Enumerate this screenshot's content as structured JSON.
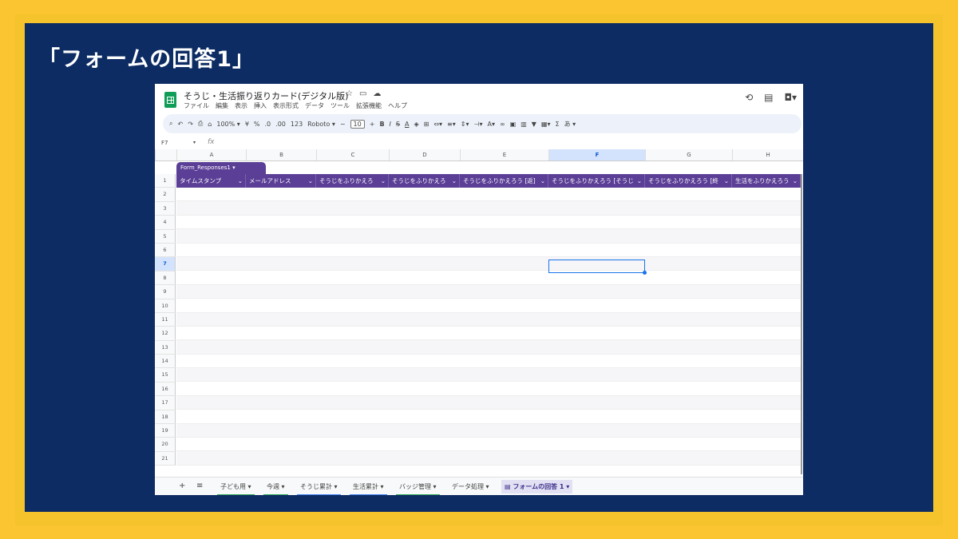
{
  "slide": {
    "title": "「フォームの回答1」"
  },
  "app": {
    "doc_title": "そうじ・生活振り返りカード(デジタル版)",
    "title_icons": [
      "star-icon",
      "folder-move-icon",
      "cloud-status-icon"
    ],
    "menu": [
      "ファイル",
      "編集",
      "表示",
      "挿入",
      "表示形式",
      "データ",
      "ツール",
      "拡張機能",
      "ヘルプ"
    ],
    "right_icons": [
      "history-icon",
      "comment-icon",
      "meet-icon"
    ]
  },
  "toolbar": {
    "zoom": "100%",
    "currency": "¥",
    "percent": "%",
    "dec_dec": ".0",
    "dec_inc": ".00",
    "number_format": "123",
    "font": "Roboto",
    "font_size": "10",
    "ime_label": "あ"
  },
  "formula_bar": {
    "name_box": "F7",
    "fx": "fx"
  },
  "columns": [
    "A",
    "B",
    "C",
    "D",
    "E",
    "F",
    "G",
    "H"
  ],
  "selected_column": "F",
  "table": {
    "name": "Form_Responses1",
    "headers": [
      "タイムスタンプ",
      "メールアドレス",
      "そうじをふりかえろ",
      "そうじをふりかえろ",
      "そうじをふりかえろう [返]",
      "そうじをふりかえろう [そうじ",
      "そうじをふりかえろう [終",
      "生活をふりかえろう"
    ]
  },
  "rows": [
    "1",
    "2",
    "3",
    "4",
    "5",
    "6",
    "7",
    "8",
    "9",
    "10",
    "11",
    "12",
    "13",
    "14",
    "15",
    "16",
    "17",
    "18",
    "19",
    "20",
    "21"
  ],
  "selected_row": "7",
  "sheets": [
    {
      "label": "子ども用",
      "color": "#34a853"
    },
    {
      "label": "今週",
      "color": "#34a853"
    },
    {
      "label": "そうじ累計",
      "color": "#4285f4"
    },
    {
      "label": "生活累計",
      "color": "#4285f4"
    },
    {
      "label": "バッジ管理",
      "color": "#34a853"
    },
    {
      "label": "データ処理",
      "color": ""
    },
    {
      "label": "フォームの回答 1",
      "color": ""
    }
  ]
}
